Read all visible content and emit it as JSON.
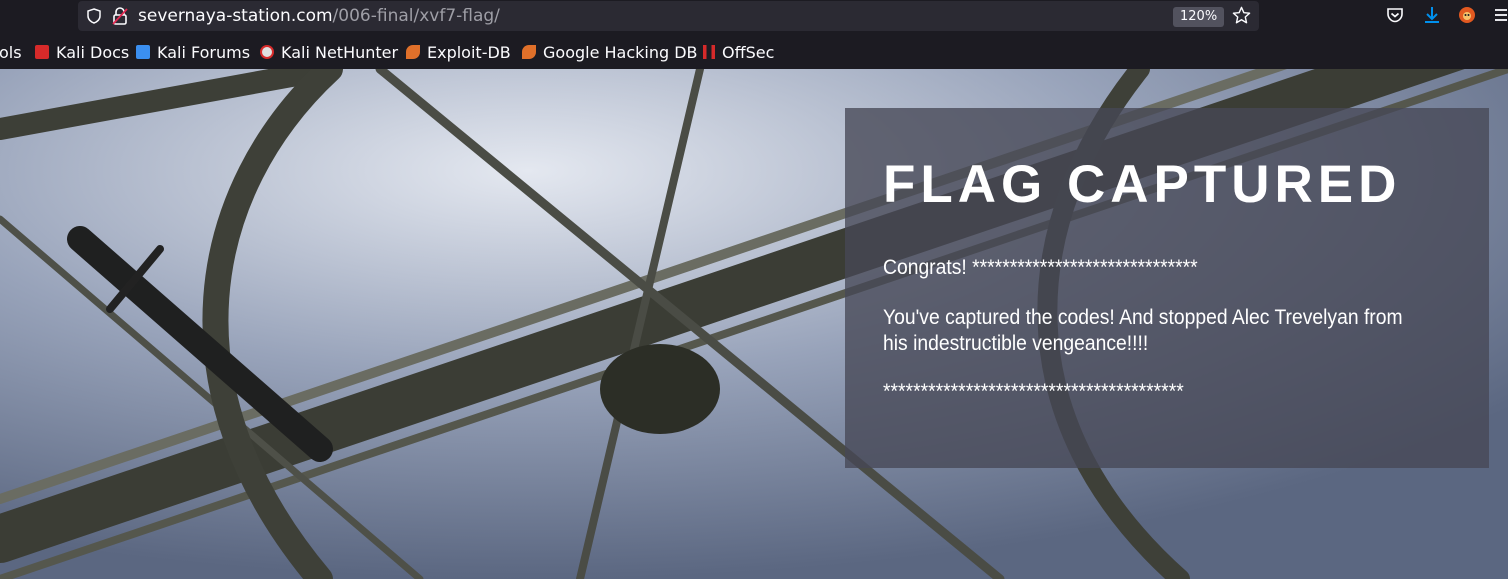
{
  "browser": {
    "url_domain": "severnaya-station.com",
    "url_path": "/006-final/xvf7-flag/",
    "zoom": "120%",
    "bookmarks": [
      {
        "label": "ols",
        "icon": "folder-icon"
      },
      {
        "label": "Kali Docs",
        "icon": "kali-docs-icon"
      },
      {
        "label": "Kali Forums",
        "icon": "kali-forums-icon"
      },
      {
        "label": "Kali NetHunter",
        "icon": "nethunter-icon"
      },
      {
        "label": "Exploit-DB",
        "icon": "exploitdb-icon"
      },
      {
        "label": "Google Hacking DB",
        "icon": "ghdb-icon"
      },
      {
        "label": "OffSec",
        "icon": "offsec-icon"
      }
    ]
  },
  "flag": {
    "title": "FLAG CAPTURED",
    "congrats": "Congrats! ******************************",
    "message": "You've captured the codes! And stopped Alec Trevelyan from his indestructible vengeance!!!!",
    "footer": "****************************************"
  },
  "colors": {
    "chrome_bg": "#1c1b22",
    "urlbar_bg": "#2b2a33",
    "panel_bg": "rgba(70,72,86,0.78)",
    "text": "#ffffff"
  }
}
